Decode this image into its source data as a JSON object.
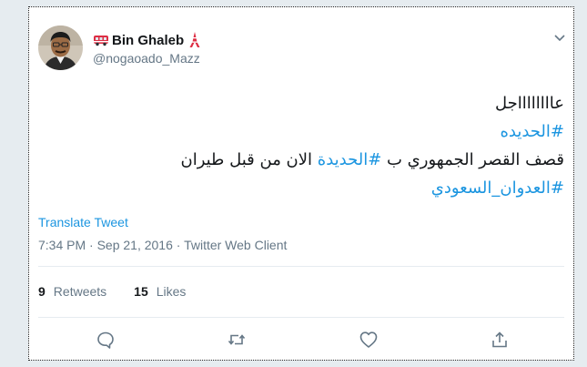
{
  "tweet": {
    "display_name": "Bin Ghaleb",
    "handle": "@nogaoado_Mazz",
    "body_lines": [
      {
        "text": "عااااااااجل",
        "hashtag": false
      },
      {
        "text": "#الحديده",
        "hashtag": true
      },
      {
        "prefix": "قصف القصر الجمهوري ب ",
        "hashtag_text": "#الحديدة",
        "suffix": " الان من قبل طيران"
      },
      {
        "text": "#العدوان_السعودي",
        "hashtag": true
      }
    ],
    "translate_label": "Translate Tweet",
    "timestamp": "7:34 PM · Sep 21, 2016 · Twitter Web Client",
    "retweets": {
      "count": "9",
      "label": "Retweets"
    },
    "likes": {
      "count": "15",
      "label": "Likes"
    }
  },
  "icons": {
    "name_prefix": "bus-emoji-icon",
    "name_suffix": "tower-emoji-icon",
    "caret": "chevron-down-icon",
    "reply": "reply-icon",
    "retweet": "retweet-icon",
    "like": "heart-icon",
    "share": "share-icon"
  },
  "colors": {
    "link": "#1b95e0",
    "text": "#14171a",
    "muted": "#657786",
    "background": "#e6ecf0"
  }
}
